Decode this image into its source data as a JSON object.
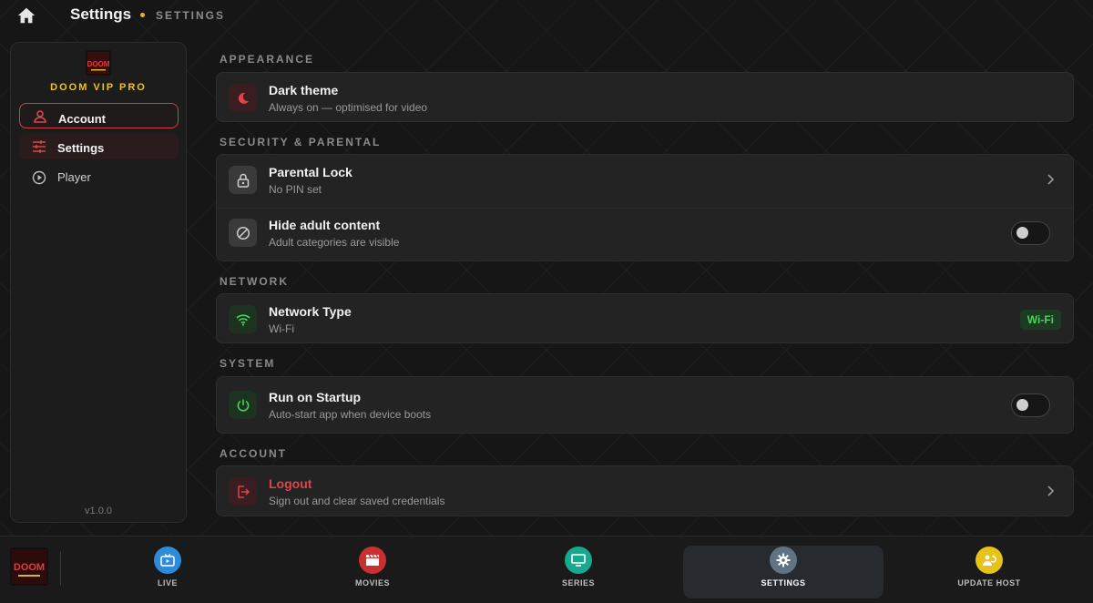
{
  "header": {
    "title": "Settings",
    "breadcrumb": "SETTINGS"
  },
  "sidebar": {
    "brand": "DOOM VIP PRO",
    "logo_text": "DOOM",
    "items": [
      {
        "label": "Account",
        "icon": "user-icon",
        "state": "focused"
      },
      {
        "label": "Settings",
        "icon": "sliders-icon",
        "state": "active"
      },
      {
        "label": "Player",
        "icon": "play-circle-icon",
        "state": "normal"
      }
    ],
    "version": "v1.0.0"
  },
  "sections": {
    "appearance": {
      "label": "APPEARANCE",
      "dark_theme": {
        "title": "Dark theme",
        "subtitle": "Always on — optimised for video",
        "icon": "moon-icon"
      }
    },
    "security": {
      "label": "SECURITY & PARENTAL",
      "parental_lock": {
        "title": "Parental Lock",
        "subtitle": "No PIN set",
        "icon": "lock-icon"
      },
      "hide_adult": {
        "title": "Hide adult content",
        "subtitle": "Adult categories are visible",
        "icon": "block-icon",
        "enabled": false
      }
    },
    "network": {
      "label": "NETWORK",
      "network_type": {
        "title": "Network Type",
        "subtitle": "Wi-Fi",
        "badge": "Wi-Fi",
        "icon": "wifi-icon"
      }
    },
    "system": {
      "label": "SYSTEM",
      "run_on_startup": {
        "title": "Run on Startup",
        "subtitle": "Auto-start app when device boots",
        "icon": "power-icon",
        "enabled": false
      }
    },
    "account": {
      "label": "ACCOUNT",
      "logout": {
        "title": "Logout",
        "subtitle": "Sign out and clear saved credentials",
        "icon": "logout-icon"
      }
    }
  },
  "bottom_nav": {
    "tabs": [
      {
        "label": "LIVE",
        "icon": "tv-icon",
        "color": "#2e8bd8"
      },
      {
        "label": "MOVIES",
        "icon": "clapperboard-icon",
        "color": "#c93030"
      },
      {
        "label": "SERIES",
        "icon": "monitor-icon",
        "color": "#18a88f"
      },
      {
        "label": "SETTINGS",
        "icon": "gear-icon",
        "color": "#5f7384",
        "active": true
      },
      {
        "label": "UPDATE HOST",
        "icon": "update-host-icon",
        "color": "#e6c21a"
      }
    ]
  },
  "colors": {
    "accent_red": "#d24040",
    "brand_yellow": "#f0c419",
    "wifi_green": "#4cd35e",
    "background": "#161616"
  }
}
